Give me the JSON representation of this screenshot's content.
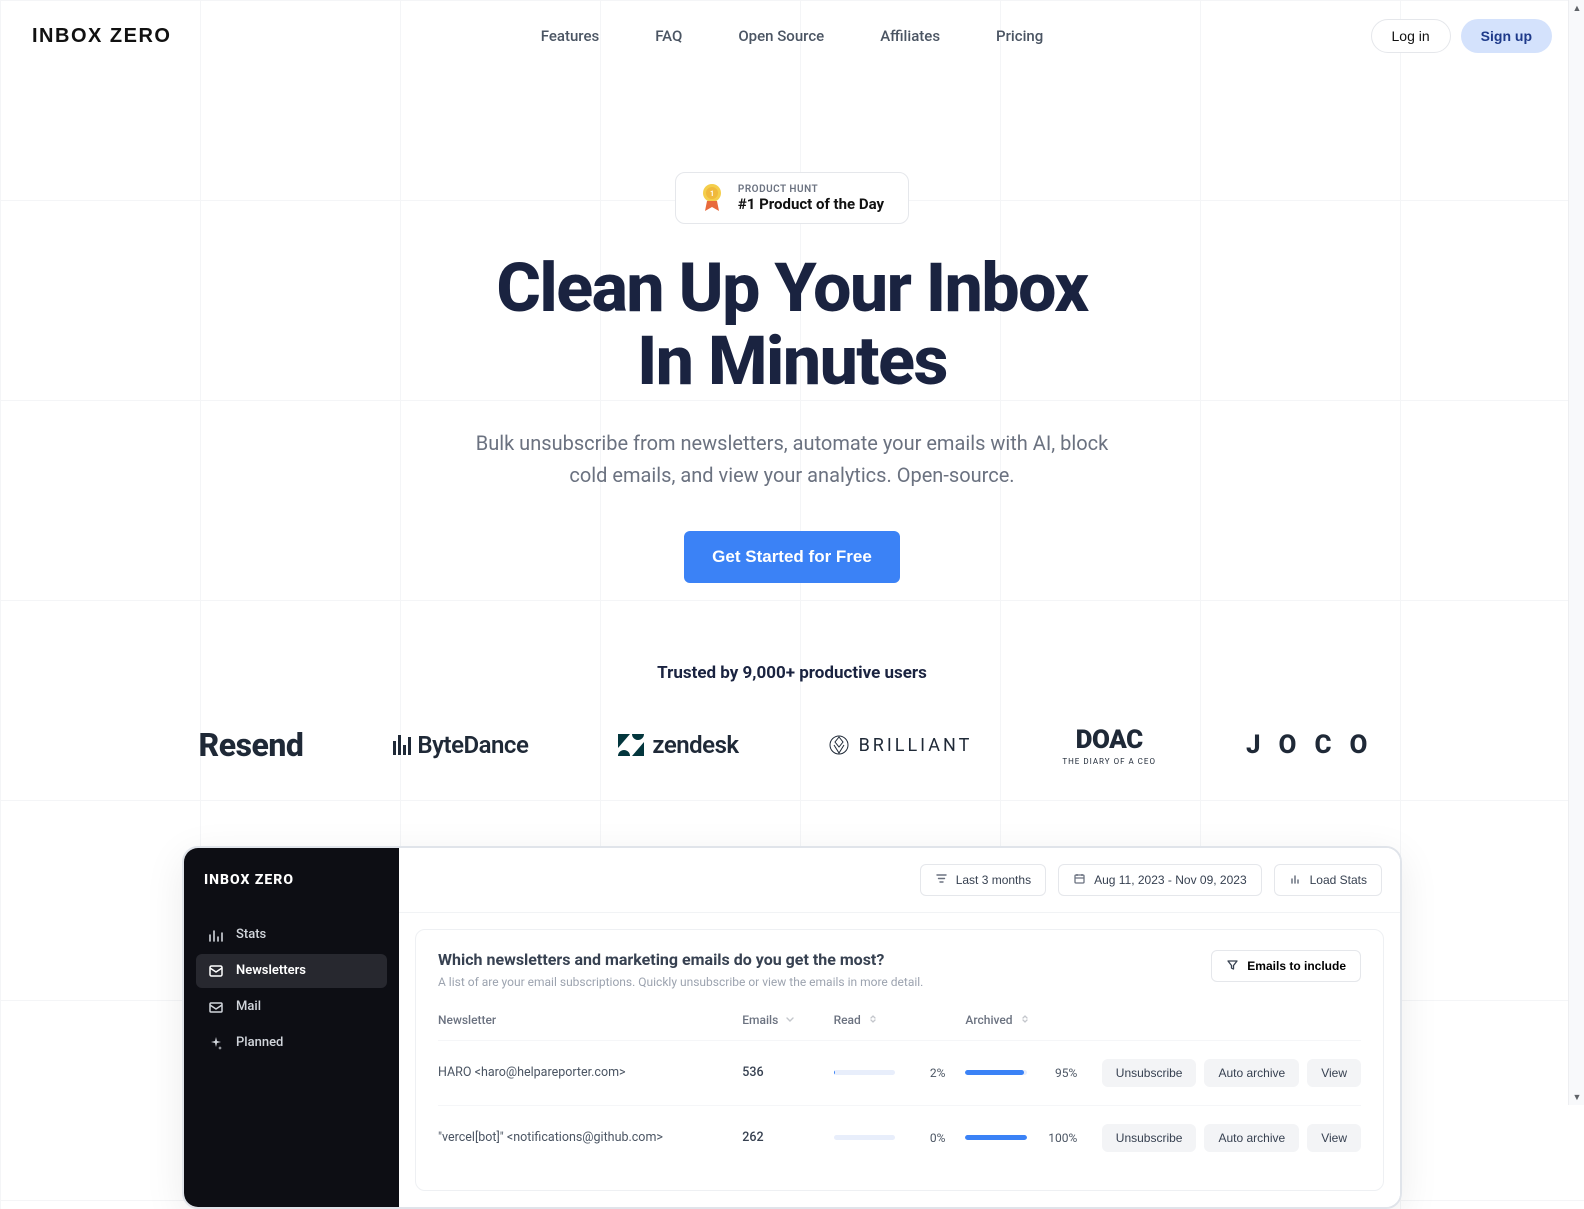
{
  "header": {
    "logo": "INBOX ZERO",
    "nav": [
      "Features",
      "FAQ",
      "Open Source",
      "Affiliates",
      "Pricing"
    ],
    "login": "Log in",
    "signup": "Sign up"
  },
  "hero": {
    "badge_label": "PRODUCT HUNT",
    "badge_title": "#1 Product of the Day",
    "headline_l1": "Clean Up Your Inbox",
    "headline_l2": "In Minutes",
    "subhead": "Bulk unsubscribe from newsletters, automate your emails with AI, block cold emails, and view your analytics. Open-source.",
    "cta": "Get Started for Free"
  },
  "social": {
    "text": "Trusted by 9,000+ productive users",
    "logos": {
      "resend": "Resend",
      "bytedance": "ByteDance",
      "zendesk": "zendesk",
      "brilliant": "BRILLIANT",
      "doac": "DOAC",
      "doac_tag": "THE DIARY OF A CEO",
      "joco": "JOCO"
    }
  },
  "preview": {
    "sidebar_logo": "INBOX ZERO",
    "sidebar": [
      {
        "label": "Stats",
        "icon": "bar-chart-icon",
        "active": false
      },
      {
        "label": "Newsletters",
        "icon": "newsletter-icon",
        "active": true
      },
      {
        "label": "Mail",
        "icon": "mail-icon",
        "active": false
      },
      {
        "label": "Planned",
        "icon": "sparkle-icon",
        "active": false
      }
    ],
    "toolbar": {
      "range_label": "Last 3 months",
      "date_label": "Aug 11, 2023 - Nov 09, 2023",
      "load_label": "Load Stats"
    },
    "panel": {
      "title": "Which newsletters and marketing emails do you get the most?",
      "sub": "A list of are your email subscriptions. Quickly unsubscribe or view the emails in more detail.",
      "action": "Emails to include",
      "columns": [
        "Newsletter",
        "Emails",
        "Read",
        "Archived"
      ],
      "buttons": {
        "unsub": "Unsubscribe",
        "archive": "Auto archive",
        "view": "View"
      },
      "rows": [
        {
          "name": "HARO <haro@helpareporter.com>",
          "emails": "536",
          "read_pct": "2%",
          "read_val": 2,
          "arch_pct": "95%",
          "arch_val": 95
        },
        {
          "name": "\"vercel[bot]\" <notifications@github.com>",
          "emails": "262",
          "read_pct": "0%",
          "read_val": 0,
          "arch_pct": "100%",
          "arch_val": 100
        }
      ]
    }
  }
}
